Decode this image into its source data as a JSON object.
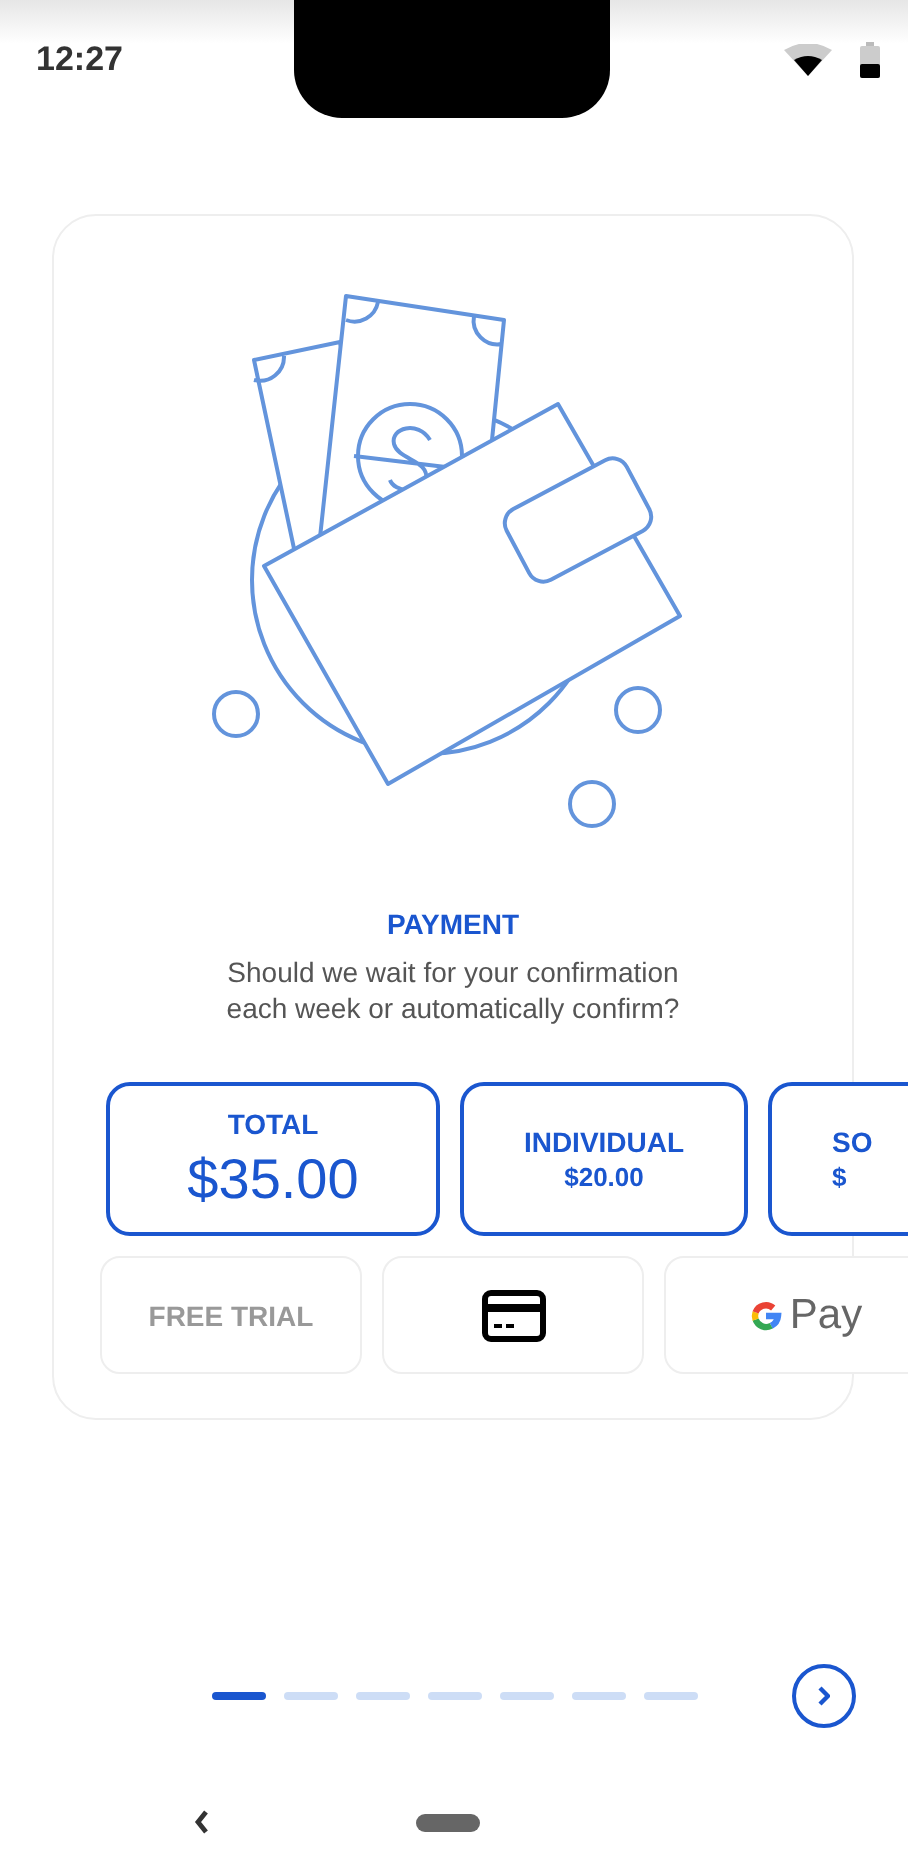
{
  "status_bar": {
    "time": "12:27"
  },
  "card": {
    "title": "PAYMENT",
    "subtitle": "Should we wait for your confirmation each week or automatically confirm?",
    "options": [
      {
        "kind": "total",
        "label": "TOTAL",
        "price": "$35.00"
      },
      {
        "kind": "item",
        "label": "INDIVIDUAL",
        "price": "$20.00"
      },
      {
        "kind": "item",
        "label": "SO",
        "price": "$"
      }
    ],
    "methods": [
      {
        "kind": "text",
        "label": "FREE TRIAL"
      },
      {
        "kind": "card"
      },
      {
        "kind": "gpay",
        "label": "Pay"
      }
    ]
  },
  "pager": {
    "pages": [
      {
        "selected": true
      },
      {
        "selected": false
      },
      {
        "selected": false
      },
      {
        "selected": false
      },
      {
        "selected": false
      },
      {
        "selected": false
      },
      {
        "selected": false
      }
    ]
  }
}
